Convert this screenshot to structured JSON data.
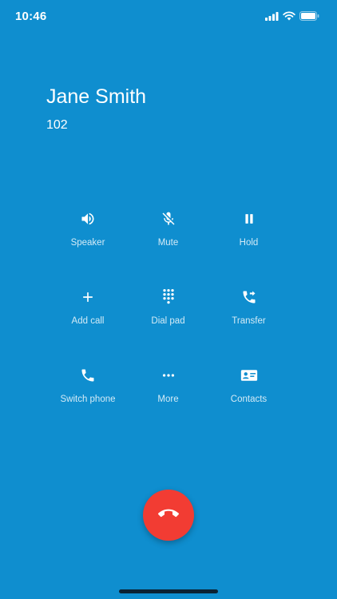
{
  "status": {
    "time": "10:46",
    "icons": [
      "signal-icon",
      "wifi-icon",
      "battery-icon"
    ]
  },
  "call": {
    "name": "Jane Smith",
    "number": "102"
  },
  "controls": [
    {
      "label": "Speaker",
      "icon": "speaker-icon"
    },
    {
      "label": "Mute",
      "icon": "mic-off-icon"
    },
    {
      "label": "Hold",
      "icon": "pause-icon"
    },
    {
      "label": "Add call",
      "icon": "plus-icon"
    },
    {
      "label": "Dial pad",
      "icon": "dialpad-icon"
    },
    {
      "label": "Transfer",
      "icon": "transfer-call-icon"
    },
    {
      "label": "Switch phone",
      "icon": "phone-icon"
    },
    {
      "label": "More",
      "icon": "more-horizontal-icon"
    },
    {
      "label": "Contacts",
      "icon": "contact-card-icon"
    }
  ],
  "end_call": {
    "icon": "end-call-icon"
  },
  "colors": {
    "background": "#0f8ecf",
    "end_call": "#f23c33",
    "text": "#ffffff"
  }
}
